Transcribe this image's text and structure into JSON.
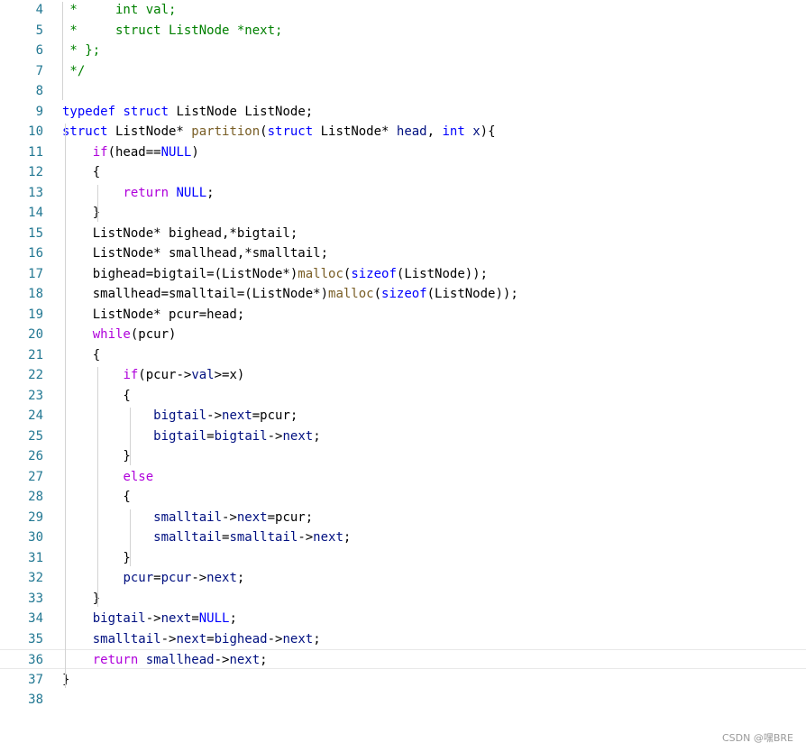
{
  "editor": {
    "colors": {
      "comment": "#008000",
      "keyword": "#0000ff",
      "control": "#af00db",
      "function": "#795e26",
      "variable": "#001080",
      "plain": "#000000",
      "line_number": "#237893"
    },
    "current_line": 36,
    "lines": [
      {
        "n": "4",
        "tokens": [
          {
            "t": " *     int val;",
            "c": "comment"
          }
        ]
      },
      {
        "n": "5",
        "tokens": [
          {
            "t": " *     struct ListNode *next;",
            "c": "comment"
          }
        ]
      },
      {
        "n": "6",
        "tokens": [
          {
            "t": " * };",
            "c": "comment"
          }
        ]
      },
      {
        "n": "7",
        "tokens": [
          {
            "t": " */",
            "c": "comment"
          }
        ]
      },
      {
        "n": "8",
        "tokens": []
      },
      {
        "n": "9",
        "tokens": [
          {
            "t": "typedef",
            "c": "kw"
          },
          {
            "t": " ",
            "c": "plain"
          },
          {
            "t": "struct",
            "c": "kw"
          },
          {
            "t": " ListNode ListNode;",
            "c": "plain"
          }
        ]
      },
      {
        "n": "10",
        "tokens": [
          {
            "t": "struct",
            "c": "kw"
          },
          {
            "t": " ListNode* ",
            "c": "plain"
          },
          {
            "t": "partition",
            "c": "fn"
          },
          {
            "t": "(",
            "c": "plain"
          },
          {
            "t": "struct",
            "c": "kw"
          },
          {
            "t": " ListNode* ",
            "c": "plain"
          },
          {
            "t": "head",
            "c": "param"
          },
          {
            "t": ", ",
            "c": "plain"
          },
          {
            "t": "int",
            "c": "kw"
          },
          {
            "t": " ",
            "c": "plain"
          },
          {
            "t": "x",
            "c": "param"
          },
          {
            "t": "){",
            "c": "plain"
          }
        ]
      },
      {
        "n": "11",
        "tokens": [
          {
            "t": "    ",
            "c": "plain"
          },
          {
            "t": "if",
            "c": "ctrl"
          },
          {
            "t": "(head==",
            "c": "plain"
          },
          {
            "t": "NULL",
            "c": "kw"
          },
          {
            "t": ")",
            "c": "plain"
          }
        ]
      },
      {
        "n": "12",
        "tokens": [
          {
            "t": "    {",
            "c": "plain"
          }
        ]
      },
      {
        "n": "13",
        "tokens": [
          {
            "t": "        ",
            "c": "plain"
          },
          {
            "t": "return",
            "c": "ctrl"
          },
          {
            "t": " ",
            "c": "plain"
          },
          {
            "t": "NULL",
            "c": "kw"
          },
          {
            "t": ";",
            "c": "plain"
          }
        ]
      },
      {
        "n": "14",
        "tokens": [
          {
            "t": "    }",
            "c": "plain"
          }
        ]
      },
      {
        "n": "15",
        "tokens": [
          {
            "t": "    ListNode* bighead,*bigtail;",
            "c": "plain"
          }
        ]
      },
      {
        "n": "16",
        "tokens": [
          {
            "t": "    ListNode* smallhead,*smalltail;",
            "c": "plain"
          }
        ]
      },
      {
        "n": "17",
        "tokens": [
          {
            "t": "    bighead=bigtail=(ListNode*)",
            "c": "plain"
          },
          {
            "t": "malloc",
            "c": "fn"
          },
          {
            "t": "(",
            "c": "plain"
          },
          {
            "t": "sizeof",
            "c": "kw"
          },
          {
            "t": "(ListNode));",
            "c": "plain"
          }
        ]
      },
      {
        "n": "18",
        "tokens": [
          {
            "t": "    smallhead=smalltail=(ListNode*)",
            "c": "plain"
          },
          {
            "t": "malloc",
            "c": "fn"
          },
          {
            "t": "(",
            "c": "plain"
          },
          {
            "t": "sizeof",
            "c": "kw"
          },
          {
            "t": "(ListNode));",
            "c": "plain"
          }
        ]
      },
      {
        "n": "19",
        "tokens": [
          {
            "t": "    ListNode* pcur=head;",
            "c": "plain"
          }
        ]
      },
      {
        "n": "20",
        "tokens": [
          {
            "t": "    ",
            "c": "plain"
          },
          {
            "t": "while",
            "c": "ctrl"
          },
          {
            "t": "(pcur)",
            "c": "plain"
          }
        ]
      },
      {
        "n": "21",
        "tokens": [
          {
            "t": "    {",
            "c": "plain"
          }
        ]
      },
      {
        "n": "22",
        "tokens": [
          {
            "t": "        ",
            "c": "plain"
          },
          {
            "t": "if",
            "c": "ctrl"
          },
          {
            "t": "(pcur->",
            "c": "plain"
          },
          {
            "t": "val",
            "c": "param"
          },
          {
            "t": ">=x)",
            "c": "plain"
          }
        ]
      },
      {
        "n": "23",
        "tokens": [
          {
            "t": "        {",
            "c": "plain"
          }
        ]
      },
      {
        "n": "24",
        "tokens": [
          {
            "t": "            ",
            "c": "plain"
          },
          {
            "t": "bigtail",
            "c": "param"
          },
          {
            "t": "->",
            "c": "plain"
          },
          {
            "t": "next",
            "c": "param"
          },
          {
            "t": "=pcur;",
            "c": "plain"
          }
        ]
      },
      {
        "n": "25",
        "tokens": [
          {
            "t": "            ",
            "c": "plain"
          },
          {
            "t": "bigtail",
            "c": "param"
          },
          {
            "t": "=",
            "c": "plain"
          },
          {
            "t": "bigtail",
            "c": "param"
          },
          {
            "t": "->",
            "c": "plain"
          },
          {
            "t": "next",
            "c": "param"
          },
          {
            "t": ";",
            "c": "plain"
          }
        ]
      },
      {
        "n": "26",
        "tokens": [
          {
            "t": "        }",
            "c": "plain"
          }
        ]
      },
      {
        "n": "27",
        "tokens": [
          {
            "t": "        ",
            "c": "plain"
          },
          {
            "t": "else",
            "c": "ctrl"
          }
        ]
      },
      {
        "n": "28",
        "tokens": [
          {
            "t": "        {",
            "c": "plain"
          }
        ]
      },
      {
        "n": "29",
        "tokens": [
          {
            "t": "            ",
            "c": "plain"
          },
          {
            "t": "smalltail",
            "c": "param"
          },
          {
            "t": "->",
            "c": "plain"
          },
          {
            "t": "next",
            "c": "param"
          },
          {
            "t": "=pcur;",
            "c": "plain"
          }
        ]
      },
      {
        "n": "30",
        "tokens": [
          {
            "t": "            ",
            "c": "plain"
          },
          {
            "t": "smalltail",
            "c": "param"
          },
          {
            "t": "=",
            "c": "plain"
          },
          {
            "t": "smalltail",
            "c": "param"
          },
          {
            "t": "->",
            "c": "plain"
          },
          {
            "t": "next",
            "c": "param"
          },
          {
            "t": ";",
            "c": "plain"
          }
        ]
      },
      {
        "n": "31",
        "tokens": [
          {
            "t": "        }",
            "c": "plain"
          }
        ]
      },
      {
        "n": "32",
        "tokens": [
          {
            "t": "        ",
            "c": "plain"
          },
          {
            "t": "pcur",
            "c": "param"
          },
          {
            "t": "=",
            "c": "plain"
          },
          {
            "t": "pcur",
            "c": "param"
          },
          {
            "t": "->",
            "c": "plain"
          },
          {
            "t": "next",
            "c": "param"
          },
          {
            "t": ";",
            "c": "plain"
          }
        ]
      },
      {
        "n": "33",
        "tokens": [
          {
            "t": "    }",
            "c": "plain"
          }
        ]
      },
      {
        "n": "34",
        "tokens": [
          {
            "t": "    ",
            "c": "plain"
          },
          {
            "t": "bigtail",
            "c": "param"
          },
          {
            "t": "->",
            "c": "plain"
          },
          {
            "t": "next",
            "c": "param"
          },
          {
            "t": "=",
            "c": "plain"
          },
          {
            "t": "NULL",
            "c": "kw"
          },
          {
            "t": ";",
            "c": "plain"
          }
        ]
      },
      {
        "n": "35",
        "tokens": [
          {
            "t": "    ",
            "c": "plain"
          },
          {
            "t": "smalltail",
            "c": "param"
          },
          {
            "t": "->",
            "c": "plain"
          },
          {
            "t": "next",
            "c": "param"
          },
          {
            "t": "=",
            "c": "plain"
          },
          {
            "t": "bighead",
            "c": "param"
          },
          {
            "t": "->",
            "c": "plain"
          },
          {
            "t": "next",
            "c": "param"
          },
          {
            "t": ";",
            "c": "plain"
          }
        ]
      },
      {
        "n": "36",
        "tokens": [
          {
            "t": "    ",
            "c": "plain"
          },
          {
            "t": "return",
            "c": "ctrl"
          },
          {
            "t": " ",
            "c": "plain"
          },
          {
            "t": "smallhead",
            "c": "param"
          },
          {
            "t": "->",
            "c": "plain"
          },
          {
            "t": "next",
            "c": "param"
          },
          {
            "t": ";",
            "c": "plain"
          }
        ]
      },
      {
        "n": "37",
        "tokens": [
          {
            "t": "}",
            "c": "plain"
          }
        ]
      },
      {
        "n": "38",
        "tokens": []
      }
    ]
  },
  "watermark": "CSDN @嘿BRE"
}
